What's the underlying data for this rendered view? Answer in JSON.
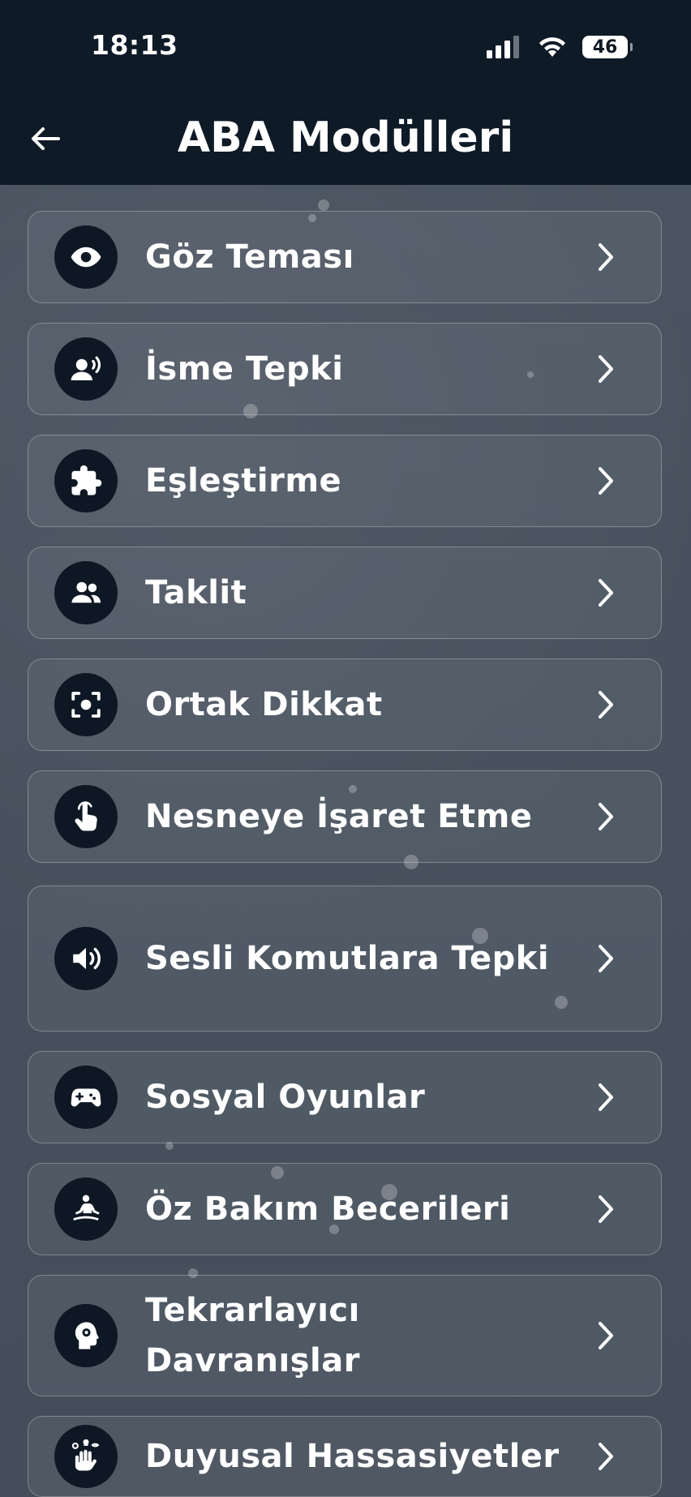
{
  "status_bar": {
    "time": "18:13",
    "battery": "46"
  },
  "header": {
    "title": "ABA Modülleri"
  },
  "modules": [
    {
      "label": "Göz Teması",
      "icon": "eye-icon"
    },
    {
      "label": "İsme Tepki",
      "icon": "person-voice-icon"
    },
    {
      "label": "Eşleştirme",
      "icon": "puzzle-icon"
    },
    {
      "label": "Taklit",
      "icon": "people-icon"
    },
    {
      "label": "Ortak Dikkat",
      "icon": "focus-icon"
    },
    {
      "label": "Nesneye İşaret Etme",
      "icon": "pointing-hand-icon"
    },
    {
      "label": "Sesli Komutlara Tepki",
      "icon": "speaker-icon"
    },
    {
      "label": "Sosyal Oyunlar",
      "icon": "gamepad-icon"
    },
    {
      "label": "Öz Bakım Becerileri",
      "icon": "meditation-icon"
    },
    {
      "label": "Tekrarlayıcı Davranışlar",
      "icon": "head-gear-icon"
    },
    {
      "label": "Duyusal Hassasiyetler",
      "icon": "sensory-hand-icon"
    }
  ]
}
